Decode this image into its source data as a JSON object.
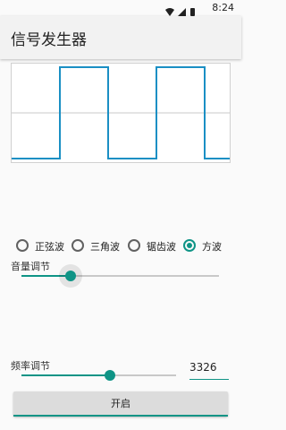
{
  "status_bar": {
    "time": "8:24",
    "icons": [
      "wifi-icon",
      "signal-icon",
      "battery-icon"
    ]
  },
  "app": {
    "title": "信号发生器"
  },
  "waveform": {
    "shape": "square",
    "color": "#1a8fc4"
  },
  "wave_types": [
    {
      "label": "正弦波",
      "checked": false
    },
    {
      "label": "三角波",
      "checked": false
    },
    {
      "label": "锯齿波",
      "checked": false
    },
    {
      "label": "方波",
      "checked": true
    }
  ],
  "volume": {
    "label": "音量调节",
    "value_fraction": 0.25
  },
  "frequency": {
    "label": "频率调节",
    "value_fraction": 0.57,
    "value": "3326"
  },
  "start_button": {
    "label": "开启"
  },
  "colors": {
    "accent": "#0f9486",
    "wave": "#1a8fc4"
  }
}
